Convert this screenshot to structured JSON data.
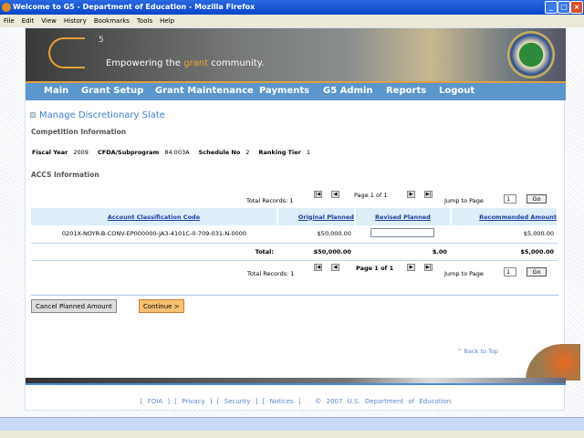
{
  "window": {
    "title": "Welcome to G5 - Department of Education - Mozilla Firefox"
  },
  "menu": [
    "File",
    "Edit",
    "View",
    "History",
    "Bookmarks",
    "Tools",
    "Help"
  ],
  "banner": {
    "logo_sup": "5",
    "tagline_pre": "Empowering the ",
    "tagline_accent": "grant",
    "tagline_post": " community."
  },
  "nav": [
    "Main",
    "Grant Setup",
    "Grant Maintenance",
    "Payments",
    "G5 Admin",
    "Reports",
    "Logout"
  ],
  "page_title": "Manage Discretionary Slate",
  "competition": {
    "heading": "Competition Information",
    "fiscal_year_label": "Fiscal Year",
    "fiscal_year": "2009",
    "cfda_label": "CFDA/Subprogram",
    "cfda": "84.003A",
    "schedule_label": "Schedule No",
    "schedule": "2",
    "tier_label": "Ranking Tier",
    "tier": "1"
  },
  "accs_heading": "ACCS Information",
  "pager": {
    "total_records": "Total Records: 1",
    "page": "Page 1 of 1",
    "jump_label": "Jump to Page",
    "jump_value": "1",
    "go": "Go"
  },
  "table": {
    "headers": [
      "Account Classification Code",
      "Original Planned",
      "Revised Planned",
      "Recommended Amount"
    ],
    "rows": [
      {
        "code": "0201X-NOYR-B-CONV-EP000000-JA3-4101C-0-709-031-N-0000",
        "original": "$50,000.00",
        "revised": "",
        "recommended": "$5,000.00"
      }
    ],
    "total": {
      "label": "Total:",
      "original": "$50,000.00",
      "revised": "$.00",
      "recommended": "$5,000.00"
    }
  },
  "buttons": {
    "cancel": "Cancel Planned Amount",
    "continue": "Continue >"
  },
  "back_to_top": "^ Back to Top",
  "footer": {
    "links": [
      "FOIA",
      "Privacy",
      "Security",
      "Notices"
    ],
    "copyright": "© 2007 U.S. Department of Education"
  }
}
